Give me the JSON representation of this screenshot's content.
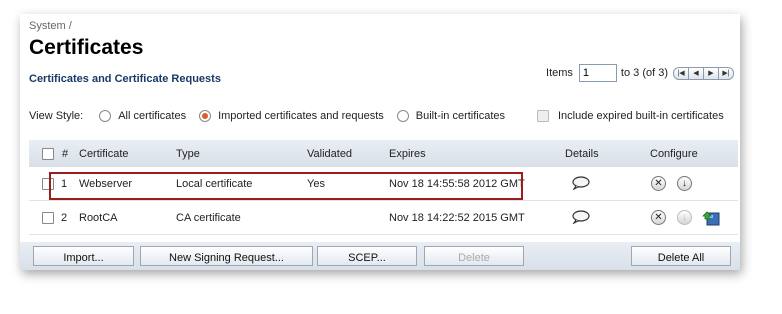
{
  "breadcrumb": "System /",
  "page_title": "Certificates",
  "section_title": "Certificates and Certificate Requests",
  "pager": {
    "items_label": "Items",
    "page_value": "1",
    "range_text": "to 3 (of 3)"
  },
  "view_style": {
    "label": "View Style:",
    "options": [
      {
        "label": "All certificates",
        "selected": false
      },
      {
        "label": "Imported certificates and requests",
        "selected": true
      },
      {
        "label": "Built-in certificates",
        "selected": false
      }
    ],
    "include_expired_label": "Include expired built-in certificates"
  },
  "table": {
    "headers": {
      "num": "#",
      "certificate": "Certificate",
      "type": "Type",
      "validated": "Validated",
      "expires": "Expires",
      "details": "Details",
      "configure": "Configure"
    },
    "rows": [
      {
        "num": "1",
        "certificate": "Webserver",
        "type": "Local certificate",
        "validated": "Yes",
        "expires": "Nov 18 14:55:58 2012 GMT"
      },
      {
        "num": "2",
        "certificate": "RootCA",
        "type": "CA certificate",
        "validated": "",
        "expires": "Nov 18 14:22:52 2015 GMT"
      }
    ]
  },
  "footer": {
    "import_label": "Import...",
    "signing_label": "New Signing Request...",
    "scep_label": "SCEP...",
    "delete_label": "Delete",
    "delete_all_label": "Delete All"
  },
  "colors": {
    "highlight": "#9b1c1c",
    "radio_selected": "#e0592b",
    "section_title": "#1a3a66"
  },
  "icons": [
    "comment-bubble-icon",
    "delete-icon",
    "download-icon",
    "ca-install-icon",
    "first-page-icon",
    "prev-page-icon",
    "next-page-icon",
    "last-page-icon"
  ]
}
